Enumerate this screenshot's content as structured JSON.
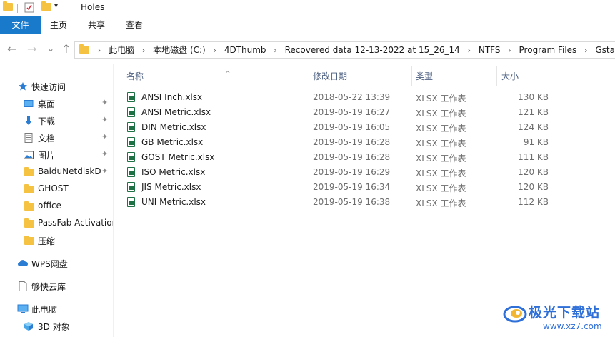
{
  "window": {
    "title": "Holes"
  },
  "ribbon": {
    "tabs": [
      "文件",
      "主页",
      "共享",
      "查看"
    ]
  },
  "nav": {
    "back": "←",
    "forward": "→",
    "dropdown": "⌄",
    "up": "↑",
    "path": [
      "此电脑",
      "本地磁盘 (C:)",
      "4DThumb",
      "Recovered data 12-13-2022 at 15_26_14",
      "NTFS",
      "Program Files",
      "Gstarsoft"
    ]
  },
  "sidebar": {
    "quick_access": "快速访问",
    "items": [
      {
        "label": "桌面",
        "pinned": true
      },
      {
        "label": "下载",
        "pinned": true
      },
      {
        "label": "文档",
        "pinned": true
      },
      {
        "label": "图片",
        "pinned": true
      },
      {
        "label": "BaiduNetdiskD",
        "pinned": true
      },
      {
        "label": "GHOST",
        "pinned": false
      },
      {
        "label": "office",
        "pinned": false
      },
      {
        "label": "PassFab Activation",
        "pinned": false
      },
      {
        "label": "压缩",
        "pinned": false
      }
    ],
    "wps": "WPS网盘",
    "gkyk": "够快云库",
    "this_pc": "此电脑",
    "objects3d": "3D 对象",
    "pin_glyph": "📌"
  },
  "columns": {
    "name": "名称",
    "modified": "修改日期",
    "type": "类型",
    "size": "大小",
    "sort_glyph": "^"
  },
  "files": [
    {
      "name": "ANSI Inch.xlsx",
      "modified": "2018-05-22 13:39",
      "type": "XLSX 工作表",
      "size": "130 KB"
    },
    {
      "name": "ANSI Metric.xlsx",
      "modified": "2019-05-19 16:27",
      "type": "XLSX 工作表",
      "size": "121 KB"
    },
    {
      "name": "DIN Metric.xlsx",
      "modified": "2019-05-19 16:05",
      "type": "XLSX 工作表",
      "size": "124 KB"
    },
    {
      "name": "GB Metric.xlsx",
      "modified": "2019-05-19 16:28",
      "type": "XLSX 工作表",
      "size": "91 KB"
    },
    {
      "name": "GOST Metric.xlsx",
      "modified": "2019-05-19 16:28",
      "type": "XLSX 工作表",
      "size": "111 KB"
    },
    {
      "name": "ISO Metric.xlsx",
      "modified": "2019-05-19 16:29",
      "type": "XLSX 工作表",
      "size": "120 KB"
    },
    {
      "name": "JIS Metric.xlsx",
      "modified": "2019-05-19 16:34",
      "type": "XLSX 工作表",
      "size": "120 KB"
    },
    {
      "name": "UNI Metric.xlsx",
      "modified": "2019-05-19 16:38",
      "type": "XLSX 工作表",
      "size": "112 KB"
    }
  ],
  "watermark": {
    "brand": "极光下载站",
    "url": "www.xz7.com"
  },
  "colors": {
    "accent": "#1979ca",
    "excel_green": "#1e7145",
    "folder": "#f5c242",
    "header_text": "#4d6082"
  }
}
